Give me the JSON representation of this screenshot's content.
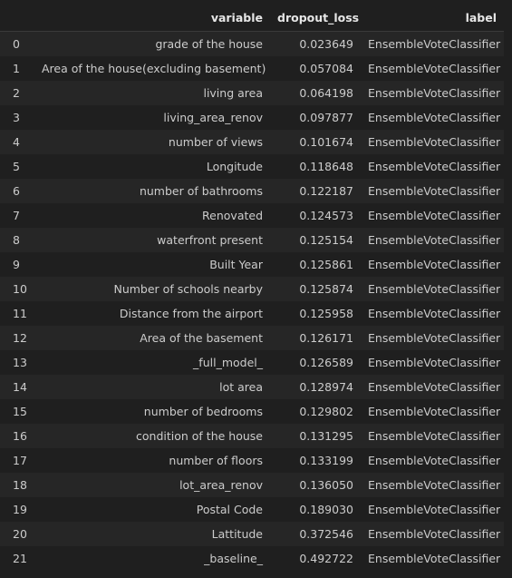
{
  "table": {
    "columns": [
      "",
      "variable",
      "dropout_loss",
      "label"
    ],
    "rows": [
      {
        "index": "0",
        "variable": "grade of the house",
        "dropout_loss": "0.023649",
        "label": "EnsembleVoteClassifier"
      },
      {
        "index": "1",
        "variable": "Area of the house(excluding basement)",
        "dropout_loss": "0.057084",
        "label": "EnsembleVoteClassifier"
      },
      {
        "index": "2",
        "variable": "living area",
        "dropout_loss": "0.064198",
        "label": "EnsembleVoteClassifier"
      },
      {
        "index": "3",
        "variable": "living_area_renov",
        "dropout_loss": "0.097877",
        "label": "EnsembleVoteClassifier"
      },
      {
        "index": "4",
        "variable": "number of views",
        "dropout_loss": "0.101674",
        "label": "EnsembleVoteClassifier"
      },
      {
        "index": "5",
        "variable": "Longitude",
        "dropout_loss": "0.118648",
        "label": "EnsembleVoteClassifier"
      },
      {
        "index": "6",
        "variable": "number of bathrooms",
        "dropout_loss": "0.122187",
        "label": "EnsembleVoteClassifier"
      },
      {
        "index": "7",
        "variable": "Renovated",
        "dropout_loss": "0.124573",
        "label": "EnsembleVoteClassifier"
      },
      {
        "index": "8",
        "variable": "waterfront present",
        "dropout_loss": "0.125154",
        "label": "EnsembleVoteClassifier"
      },
      {
        "index": "9",
        "variable": "Built Year",
        "dropout_loss": "0.125861",
        "label": "EnsembleVoteClassifier"
      },
      {
        "index": "10",
        "variable": "Number of schools nearby",
        "dropout_loss": "0.125874",
        "label": "EnsembleVoteClassifier"
      },
      {
        "index": "11",
        "variable": "Distance from the airport",
        "dropout_loss": "0.125958",
        "label": "EnsembleVoteClassifier"
      },
      {
        "index": "12",
        "variable": "Area of the basement",
        "dropout_loss": "0.126171",
        "label": "EnsembleVoteClassifier"
      },
      {
        "index": "13",
        "variable": "_full_model_",
        "dropout_loss": "0.126589",
        "label": "EnsembleVoteClassifier"
      },
      {
        "index": "14",
        "variable": "lot area",
        "dropout_loss": "0.128974",
        "label": "EnsembleVoteClassifier"
      },
      {
        "index": "15",
        "variable": "number of bedrooms",
        "dropout_loss": "0.129802",
        "label": "EnsembleVoteClassifier"
      },
      {
        "index": "16",
        "variable": "condition of the house",
        "dropout_loss": "0.131295",
        "label": "EnsembleVoteClassifier"
      },
      {
        "index": "17",
        "variable": "number of floors",
        "dropout_loss": "0.133199",
        "label": "EnsembleVoteClassifier"
      },
      {
        "index": "18",
        "variable": "lot_area_renov",
        "dropout_loss": "0.136050",
        "label": "EnsembleVoteClassifier"
      },
      {
        "index": "19",
        "variable": "Postal Code",
        "dropout_loss": "0.189030",
        "label": "EnsembleVoteClassifier"
      },
      {
        "index": "20",
        "variable": "Lattitude",
        "dropout_loss": "0.372546",
        "label": "EnsembleVoteClassifier"
      },
      {
        "index": "21",
        "variable": "_baseline_",
        "dropout_loss": "0.492722",
        "label": "EnsembleVoteClassifier"
      }
    ]
  }
}
